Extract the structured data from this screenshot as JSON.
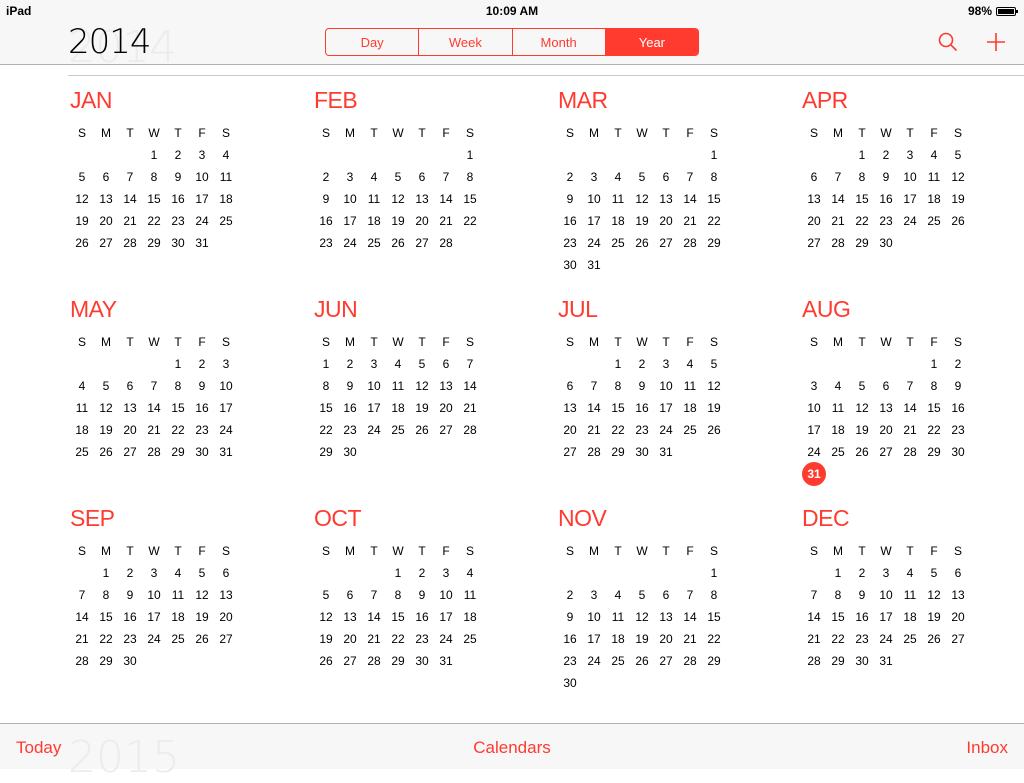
{
  "status_bar": {
    "device": "iPad",
    "time": "10:09 AM",
    "battery": "98%",
    "battery_level": 0.98
  },
  "nav": {
    "year": "2014",
    "ghost_year": "2014",
    "segments": [
      "Day",
      "Week",
      "Month",
      "Year"
    ],
    "active_segment": "Year",
    "search_icon": "search-icon",
    "add_icon": "plus-icon"
  },
  "today": {
    "month_index": 7,
    "day": 31
  },
  "weekday_labels": [
    "S",
    "M",
    "T",
    "W",
    "T",
    "F",
    "S"
  ],
  "months": [
    {
      "name": "JAN",
      "first_weekday": 3,
      "days": 31
    },
    {
      "name": "FEB",
      "first_weekday": 6,
      "days": 28
    },
    {
      "name": "MAR",
      "first_weekday": 6,
      "days": 31
    },
    {
      "name": "APR",
      "first_weekday": 2,
      "days": 30
    },
    {
      "name": "MAY",
      "first_weekday": 4,
      "days": 31
    },
    {
      "name": "JUN",
      "first_weekday": 0,
      "days": 30
    },
    {
      "name": "JUL",
      "first_weekday": 2,
      "days": 31
    },
    {
      "name": "AUG",
      "first_weekday": 5,
      "days": 31
    },
    {
      "name": "SEP",
      "first_weekday": 1,
      "days": 30
    },
    {
      "name": "OCT",
      "first_weekday": 3,
      "days": 31
    },
    {
      "name": "NOV",
      "first_weekday": 6,
      "days": 30
    },
    {
      "name": "DEC",
      "first_weekday": 1,
      "days": 31
    }
  ],
  "tab_bar": {
    "today": "Today",
    "calendars": "Calendars",
    "inbox": "Inbox",
    "ghost_next_year": "2015"
  },
  "colors": {
    "accent": "#ff3b30"
  }
}
